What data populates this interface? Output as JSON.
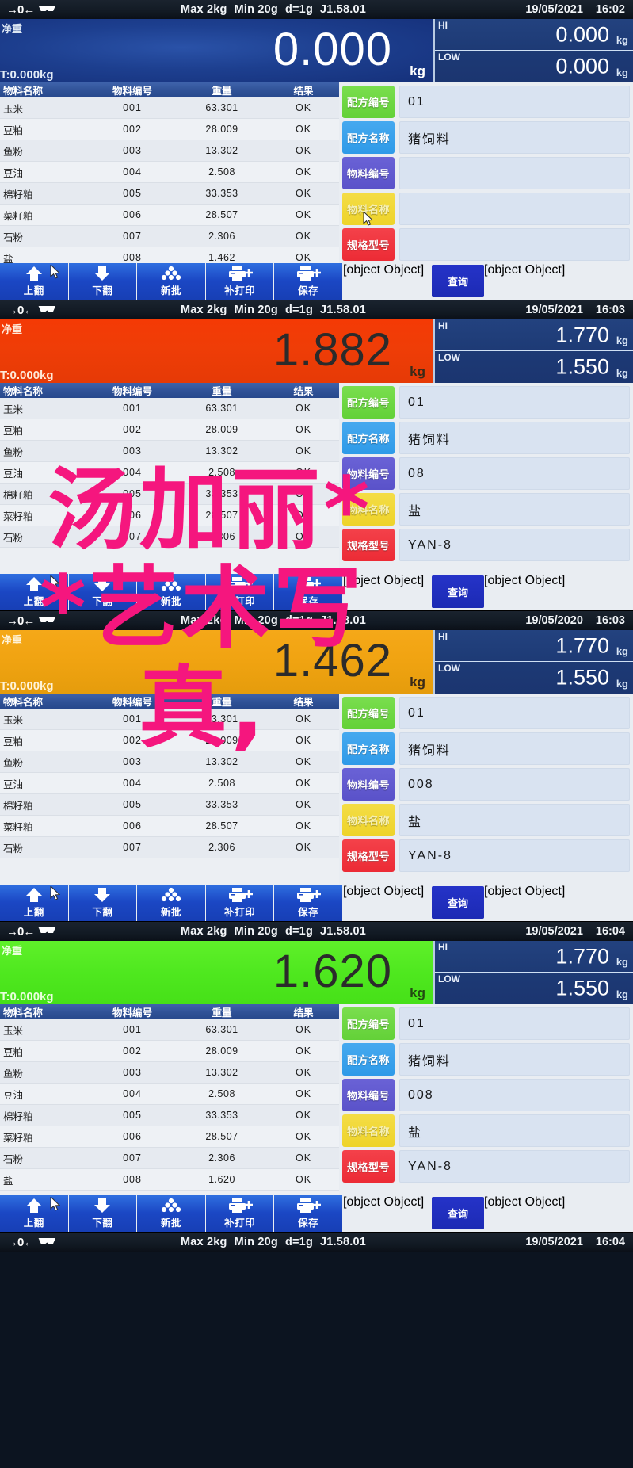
{
  "device": {
    "spec": {
      "max": "Max 2kg",
      "min": "Min 20g",
      "div": "d=1g",
      "firmware": "J1.58.01"
    },
    "net_label": "净重",
    "unit": "kg",
    "hi_label": "HI",
    "low_label": "LOW"
  },
  "table": {
    "headers": [
      "物料名称",
      "物料编号",
      "重量",
      "结果"
    ],
    "rows_full": [
      [
        "玉米",
        "001",
        "63.301",
        "OK"
      ],
      [
        "豆粕",
        "002",
        "28.009",
        "OK"
      ],
      [
        "鱼粉",
        "003",
        "13.302",
        "OK"
      ],
      [
        "豆油",
        "004",
        "2.508",
        "OK"
      ],
      [
        "棉籽粕",
        "005",
        "33.353",
        "OK"
      ],
      [
        "菜籽粕",
        "006",
        "28.507",
        "OK"
      ],
      [
        "石粉",
        "007",
        "2.306",
        "OK"
      ],
      [
        "盐",
        "008",
        "1.462",
        "OK"
      ]
    ],
    "rows_seven": [
      [
        "玉米",
        "001",
        "63.301",
        "OK"
      ],
      [
        "豆粕",
        "002",
        "28.009",
        "OK"
      ],
      [
        "鱼粉",
        "003",
        "13.302",
        "OK"
      ],
      [
        "豆油",
        "004",
        "2.508",
        "OK"
      ],
      [
        "棉籽粕",
        "005",
        "33.353",
        "OK"
      ],
      [
        "菜籽粕",
        "006",
        "28.507",
        "OK"
      ],
      [
        "石粉",
        "007",
        "2.306",
        "OK"
      ]
    ],
    "rows_last_1620": [
      [
        "玉米",
        "001",
        "63.301",
        "OK"
      ],
      [
        "豆粕",
        "002",
        "28.009",
        "OK"
      ],
      [
        "鱼粉",
        "003",
        "13.302",
        "OK"
      ],
      [
        "豆油",
        "004",
        "2.508",
        "OK"
      ],
      [
        "棉籽粕",
        "005",
        "33.353",
        "OK"
      ],
      [
        "菜籽粕",
        "006",
        "28.507",
        "OK"
      ],
      [
        "石粉",
        "007",
        "2.306",
        "OK"
      ],
      [
        "盐",
        "008",
        "1.620",
        "OK"
      ]
    ]
  },
  "field_keys": {
    "recipe_no": "配方编号",
    "recipe_name": "配方名称",
    "material_no": "物料编号",
    "material_name": "物料名称",
    "spec_model": "规格型号"
  },
  "toolbar": {
    "page_up": "上翻",
    "page_down": "下翻",
    "new_batch": "新批",
    "reprint": "补打印",
    "save": "保存",
    "query": "查询"
  },
  "colors": {
    "recipe_no": "#63d138",
    "recipe_name": "#2e9ae8",
    "material_no": "#5a52c9",
    "material_name": "#eed329",
    "spec_model": "#ec2b35",
    "query": "#1c2ab4",
    "toolbar": "#1b47c4",
    "watermark": "#f5167e"
  },
  "watermark": {
    "line1": "汤加丽*",
    "line2": "*艺术写",
    "line3": "真,"
  },
  "panels": [
    {
      "id": "panel-1",
      "date": "19/05/2021",
      "time": "16:02",
      "weight": "0.000",
      "weight_color": "blue",
      "tare": "T:0.000kg",
      "hi": "0.000",
      "low": "0.000",
      "fields": {
        "recipe_no": "01",
        "recipe_name": "猪饲料",
        "material_no": "",
        "material_name": "",
        "spec_model": ""
      },
      "rows": "rows_full"
    },
    {
      "id": "panel-2",
      "date": "19/05/2021",
      "time": "16:03",
      "weight": "1.882",
      "weight_color": "red",
      "tare": "T:0.000kg",
      "hi": "1.770",
      "low": "1.550",
      "fields": {
        "recipe_no": "01",
        "recipe_name": "猪饲料",
        "material_no": "08",
        "material_name": "盐",
        "spec_model": "YAN-8"
      },
      "rows": "rows_seven"
    },
    {
      "id": "panel-3",
      "date": "19/05/2020",
      "time": "16:03",
      "weight": "1.462",
      "weight_color": "amber",
      "tare": "T:0.000kg",
      "hi": "1.770",
      "low": "1.550",
      "fields": {
        "recipe_no": "01",
        "recipe_name": "猪饲料",
        "material_no": "008",
        "material_name": "盐",
        "spec_model": "YAN-8"
      },
      "rows": "rows_seven"
    },
    {
      "id": "panel-4",
      "date": "19/05/2021",
      "time": "16:04",
      "weight": "1.620",
      "weight_color": "green",
      "tare": "T:0.000kg",
      "hi": "1.770",
      "low": "1.550",
      "fields": {
        "recipe_no": "01",
        "recipe_name": "猪饲料",
        "material_no": "008",
        "material_name": "盐",
        "spec_model": "YAN-8"
      },
      "rows": "rows_last_1620"
    },
    {
      "id": "panel-5",
      "date": "19/05/2021",
      "time": "16:04",
      "weight": "",
      "weight_color": "blue",
      "tare": "",
      "hi": "",
      "low": "",
      "fields": {
        "recipe_no": "",
        "recipe_name": "",
        "material_no": "",
        "material_name": "",
        "spec_model": ""
      },
      "rows": "rows_full"
    }
  ]
}
